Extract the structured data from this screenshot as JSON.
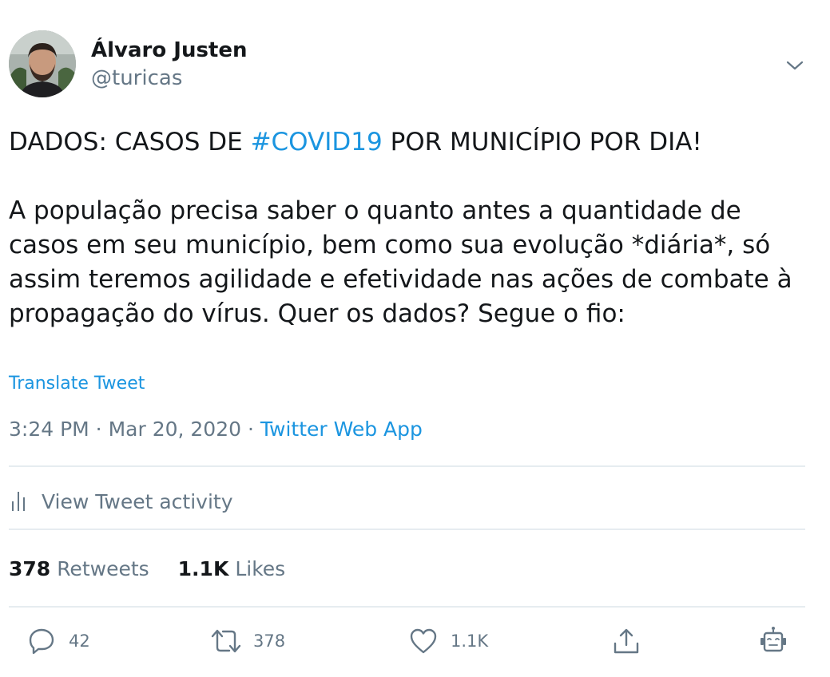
{
  "author": {
    "display_name": "Álvaro Justen",
    "handle": "@turicas"
  },
  "tweet": {
    "line1_before": "DADOS: CASOS DE ",
    "line1_hashtag": "#COVID19",
    "line1_after": " POR MUNICÍPIO POR DIA!",
    "paragraph2": "A população precisa saber o quanto antes a quantidade de casos em seu município, bem como sua evolução *diária*, só assim teremos agilidade e efetividade nas ações de combate à propagação do vírus. Quer os dados? Segue o fio:",
    "translate_label": "Translate Tweet"
  },
  "meta": {
    "time": "3:24 PM",
    "separator1": " · ",
    "date": "Mar 20, 2020",
    "separator2": " · ",
    "source": "Twitter Web App"
  },
  "activity": {
    "label": "View Tweet activity"
  },
  "stats": {
    "retweets_count": "378",
    "retweets_label": "Retweets",
    "likes_count": "1.1K",
    "likes_label": "Likes"
  },
  "actions": {
    "reply_count": "42",
    "retweet_count": "378",
    "like_count": "1.1K"
  },
  "colors": {
    "link": "#1b95e0",
    "secondary_text": "#657786",
    "primary_text": "#14171a",
    "divider": "#e6ecf0"
  },
  "icons": [
    "chevron-down-icon",
    "bar-chart-icon",
    "reply-icon",
    "retweet-icon",
    "heart-icon",
    "share-icon",
    "robot-icon"
  ]
}
